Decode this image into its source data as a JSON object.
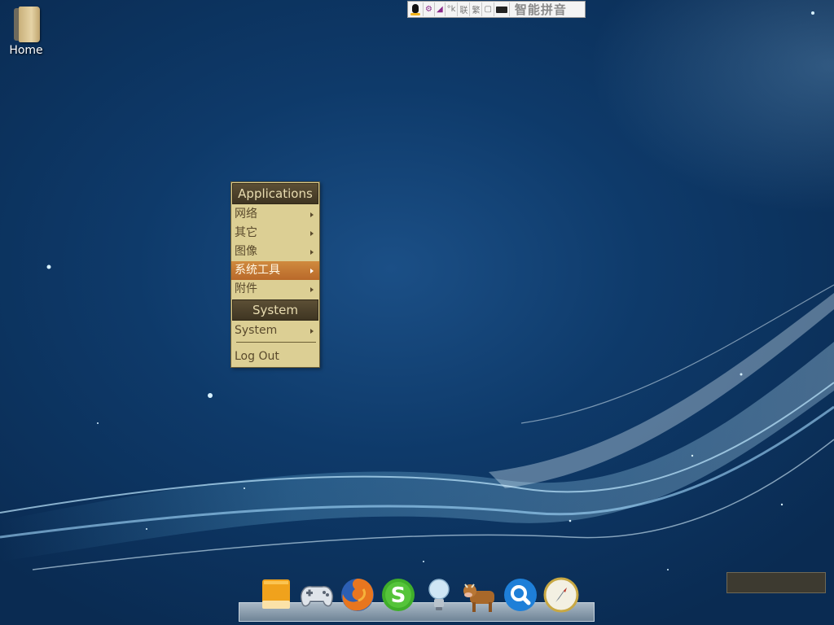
{
  "desktop": {
    "home_label": "Home"
  },
  "ime": {
    "name": "智能拼音",
    "buttons": [
      {
        "icon": "tux-icon"
      },
      {
        "icon": "settings-icon"
      },
      {
        "icon": "skin-icon"
      },
      {
        "icon": "punctuation-icon",
        "text": "°k"
      },
      {
        "icon": "association-icon",
        "text": "联"
      },
      {
        "icon": "traditional-icon",
        "text": "繁"
      },
      {
        "icon": "lock-icon",
        "text": "🔒"
      },
      {
        "icon": "keyboard-icon"
      }
    ]
  },
  "menu": {
    "applications_header": "Applications",
    "items": [
      {
        "label": "网络",
        "submenu": true
      },
      {
        "label": "其它",
        "submenu": true
      },
      {
        "label": "图像",
        "submenu": true
      },
      {
        "label": "系统工具",
        "submenu": true,
        "active": true
      },
      {
        "label": "附件",
        "submenu": true
      }
    ],
    "system_header": "System",
    "system_item": "System",
    "logout": "Log Out"
  },
  "dock": {
    "items": [
      {
        "icon": "harddrive-icon"
      },
      {
        "icon": "gamepad-icon"
      },
      {
        "icon": "firefox-icon"
      },
      {
        "icon": "skype-icon"
      },
      {
        "icon": "lightbulb-icon"
      },
      {
        "icon": "cow-icon"
      },
      {
        "icon": "search-icon"
      },
      {
        "icon": "compass-icon"
      }
    ]
  },
  "colors": {
    "menu_bg": "#dccf94",
    "menu_active": "#c37a34",
    "menu_header": "#4a3f2a"
  }
}
